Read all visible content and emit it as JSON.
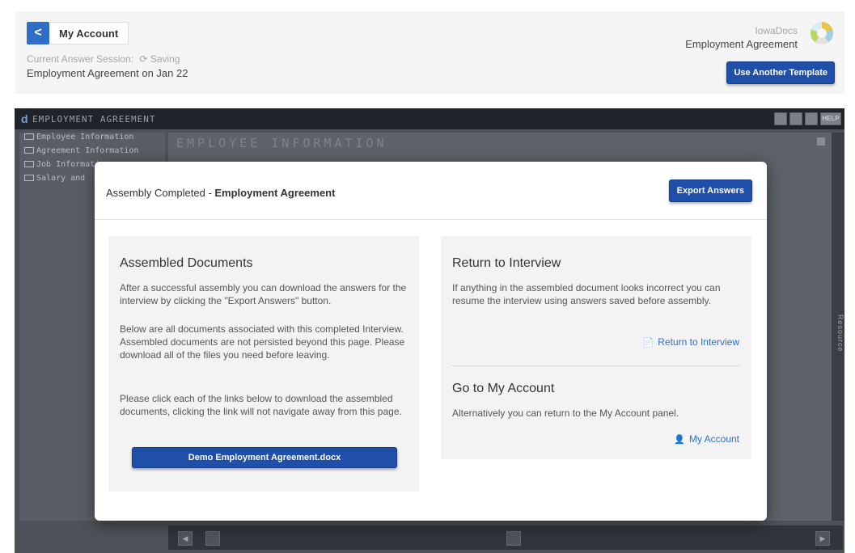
{
  "header": {
    "back_icon": "chevron-left-icon",
    "back_glyph": "<",
    "account_label": "My Account",
    "session_label": "Current Answer Session:",
    "saving_label": "Saving",
    "session_name": "Employment Agreement on Jan 22",
    "brand_name": "IowaDocs",
    "brand_document": "Employment Agreement",
    "use_template_label": "Use Another Template"
  },
  "app": {
    "logo_glyph": "d",
    "title": "EMPLOYMENT AGREEMENT",
    "help_label": "HELP",
    "tree": [
      "Employee Information",
      "Agreement Information",
      "Job Information",
      "Salary and"
    ],
    "pane_title": "EMPLOYEE INFORMATION",
    "rail_label": "Resource"
  },
  "modal": {
    "title_prefix": "Assembly Completed - ",
    "title_bold": "Employment Agreement",
    "export_label": "Export Answers",
    "assembled": {
      "heading": "Assembled Documents",
      "p1": "After a successful assembly you can download the answers for the interview by clicking the \"Export Answers\" button.",
      "p2": "Below are all documents associated with this completed Interview. Assembled documents are not persisted beyond this page. Please download all of the files you need before leaving.",
      "p3": "Please click each of the links below to download the assembled documents, clicking the link will not navigate away from this page.",
      "document_button": "Demo Employment Agreement.docx"
    },
    "return": {
      "heading": "Return to Interview",
      "text": "If anything in the assembled document looks incorrect you can resume the interview using answers saved before assembly.",
      "link": "Return to Interview",
      "icon": "file-text-icon"
    },
    "account": {
      "heading": "Go to My Account",
      "text": "Alternatively you can return to the My Account panel.",
      "link": "My Account",
      "icon": "user-icon"
    }
  },
  "colors": {
    "primary_button": "#1f4fa8",
    "link": "#2f6ec7",
    "app_header": "#1f232a"
  }
}
